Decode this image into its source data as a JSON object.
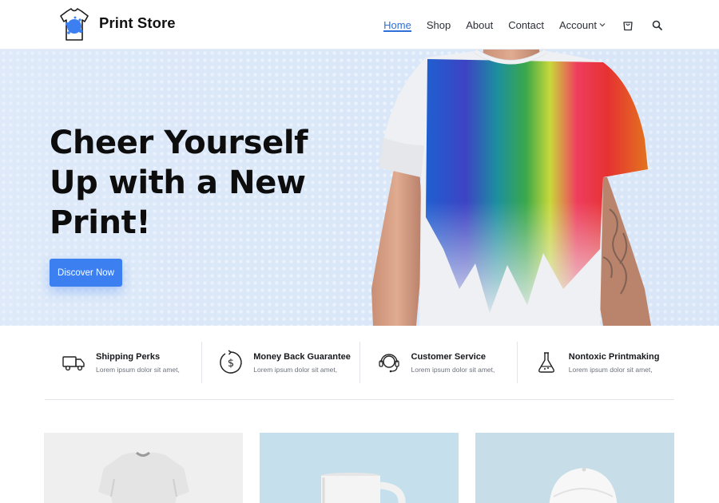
{
  "header": {
    "brand": "Print Store",
    "nav": [
      {
        "label": "Home",
        "active": true
      },
      {
        "label": "Shop",
        "active": false
      },
      {
        "label": "About",
        "active": false
      },
      {
        "label": "Contact",
        "active": false
      },
      {
        "label": "Account",
        "active": false,
        "dropdown": true
      }
    ],
    "icons": [
      "cart-icon",
      "search-icon"
    ]
  },
  "hero": {
    "title": "Cheer Yourself Up with a New Print!",
    "button_label": "Discover Now",
    "accent_color": "#3b7ff0"
  },
  "features": [
    {
      "title": "Shipping Perks",
      "subtitle": "Lorem ipsum dolor sit amet,",
      "icon": "truck-icon"
    },
    {
      "title": "Money Back Guarantee",
      "subtitle": "Lorem ipsum dolor sit amet,",
      "icon": "money-back-icon"
    },
    {
      "title": "Customer Service",
      "subtitle": "Lorem ipsum dolor sit amet,",
      "icon": "headset-icon"
    },
    {
      "title": "Nontoxic Printmaking",
      "subtitle": "Lorem ipsum dolor sit amet,",
      "icon": "flask-icon"
    }
  ],
  "products": [
    {
      "item": "t-shirt",
      "background": "#efefef"
    },
    {
      "item": "mug",
      "background": "#c5e0ec"
    },
    {
      "item": "cap",
      "background": "#c7dde7"
    }
  ]
}
